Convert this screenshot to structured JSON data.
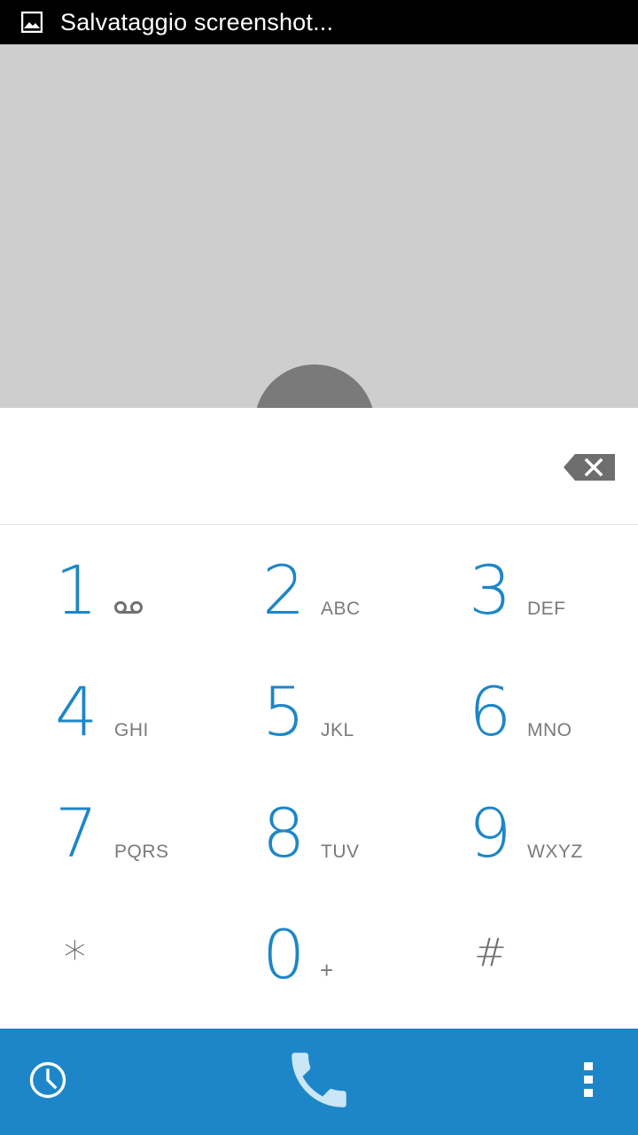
{
  "status_bar": {
    "notification_icon": "image-icon",
    "notification_text": "Salvataggio screenshot..."
  },
  "avatar": {
    "icon": "contact-avatar"
  },
  "dial_field": {
    "value": "",
    "backspace_icon": "backspace-icon"
  },
  "keypad": {
    "keys": [
      {
        "digit": "1",
        "letters": "",
        "extra_icon": "voicemail-icon"
      },
      {
        "digit": "2",
        "letters": "ABC"
      },
      {
        "digit": "3",
        "letters": "DEF"
      },
      {
        "digit": "4",
        "letters": "GHI"
      },
      {
        "digit": "5",
        "letters": "JKL"
      },
      {
        "digit": "6",
        "letters": "MNO"
      },
      {
        "digit": "7",
        "letters": "PQRS"
      },
      {
        "digit": "8",
        "letters": "TUV"
      },
      {
        "digit": "9",
        "letters": "WXYZ"
      },
      {
        "digit": "*",
        "letters": ""
      },
      {
        "digit": "0",
        "letters": "+"
      },
      {
        "digit": "#",
        "letters": ""
      }
    ]
  },
  "bottom_bar": {
    "history_icon": "clock-icon",
    "call_icon": "phone-icon",
    "menu_icon": "overflow-menu-icon"
  },
  "colors": {
    "accent": "#1c86c8",
    "status_bar": "#000000",
    "top_area": "#cecece",
    "avatar": "#7a7a7a",
    "letters": "#7a7a7a"
  }
}
